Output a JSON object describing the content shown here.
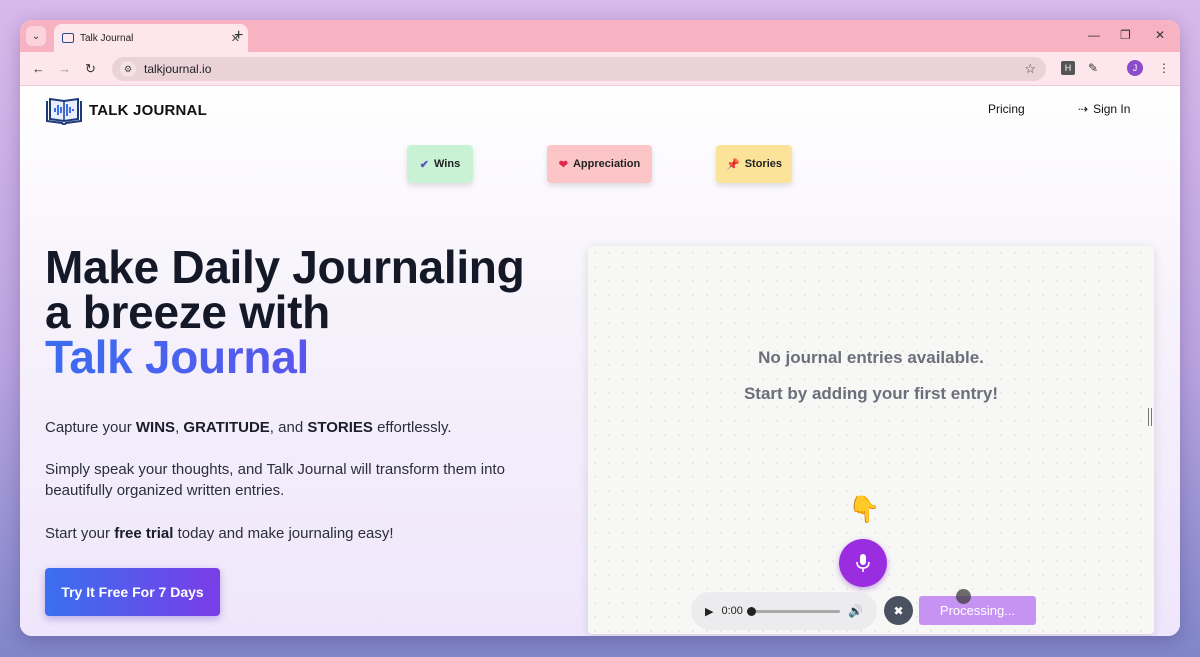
{
  "browser": {
    "tab_title": "Talk Journal",
    "url": "talkjournal.io",
    "profile_initial": "J",
    "extension_label": "H"
  },
  "header": {
    "brand": "TALK JOURNAL",
    "pricing": "Pricing",
    "sign_in": "Sign In"
  },
  "chips": {
    "wins": "Wins",
    "appreciation": "Appreciation",
    "stories": "Stories"
  },
  "hero": {
    "line1": "Make Daily Journaling",
    "line2": "a breeze with",
    "line3": "Talk Journal",
    "capture_prefix": "Capture your ",
    "capture_wins": "WINS",
    "capture_sep1": ", ",
    "capture_gratitude": "GRATITUDE",
    "capture_sep2": ", and ",
    "capture_stories": "STORIES",
    "capture_suffix": " effortlessly.",
    "speak": "Simply speak your thoughts, and Talk Journal will transform them into beautifully organized written entries.",
    "trial_prefix": "Start your ",
    "trial_bold": "free trial",
    "trial_suffix": " today and make journaling easy!",
    "cta": "Try It Free For 7 Days"
  },
  "journal": {
    "empty_title": "No journal entries available.",
    "empty_subtitle": "Start by adding your first entry!",
    "time": "0:00",
    "processing": "Processing..."
  },
  "colors": {
    "accent_start": "#3b6df0",
    "accent_end": "#7a3ee6",
    "mic": "#9b2de0",
    "processing": "#c793f3"
  }
}
